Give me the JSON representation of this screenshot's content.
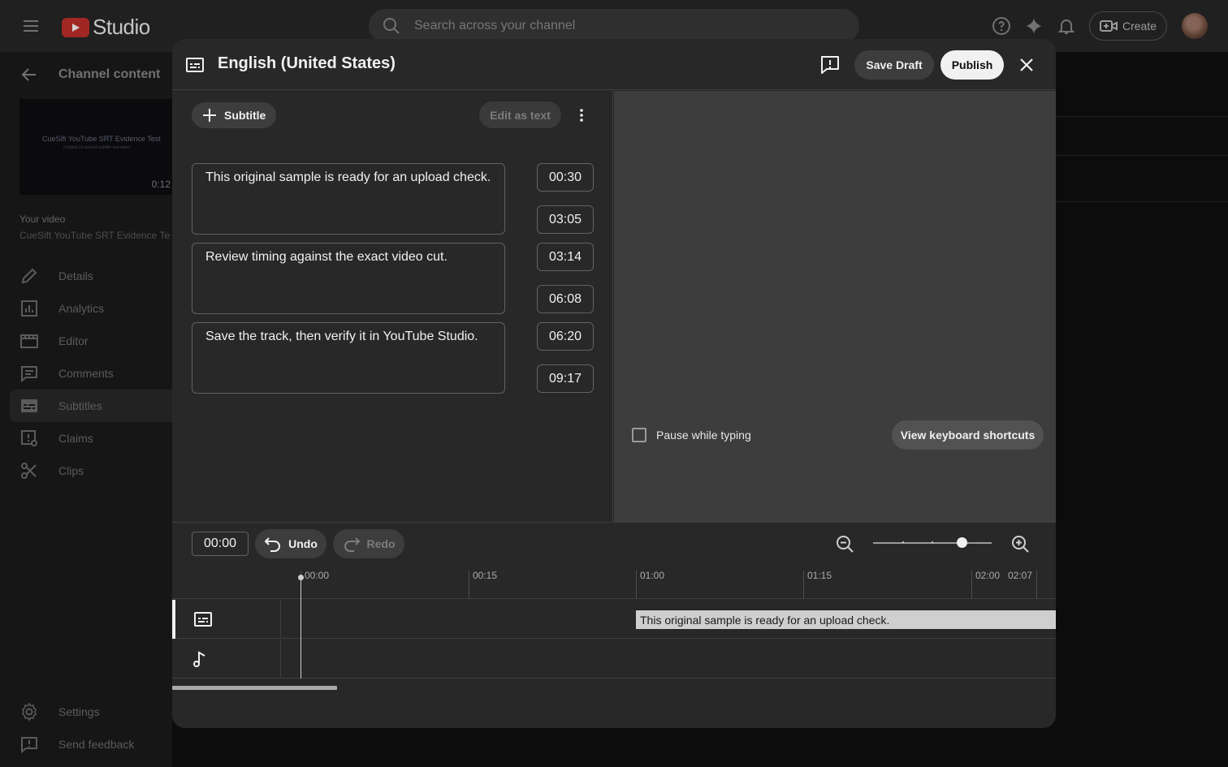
{
  "app": {
    "logo_text": "Studio",
    "search_placeholder": "Search across your channel",
    "create_label": "Create"
  },
  "sidebar": {
    "back_label": "Channel content",
    "thumbnail_title": "CueSift YouTube SRT Evidence Test",
    "thumbnail_subtitle": "Original 12-second subtitle test video",
    "thumbnail_duration": "0:12",
    "your_video_label": "Your video",
    "video_title": "CueSift YouTube SRT Evidence Test",
    "items": [
      {
        "label": "Details",
        "icon": "pencil-icon"
      },
      {
        "label": "Analytics",
        "icon": "analytics-icon"
      },
      {
        "label": "Editor",
        "icon": "film-icon"
      },
      {
        "label": "Comments",
        "icon": "comments-icon"
      },
      {
        "label": "Subtitles",
        "icon": "subtitles-icon",
        "active": true
      },
      {
        "label": "Claims",
        "icon": "claims-icon"
      },
      {
        "label": "Clips",
        "icon": "scissors-icon"
      }
    ],
    "bottom_items": [
      {
        "label": "Settings",
        "icon": "gear-icon"
      },
      {
        "label": "Send feedback",
        "icon": "feedback-icon"
      }
    ]
  },
  "modal": {
    "title": "English (United States)",
    "save_draft_label": "Save Draft",
    "publish_label": "Publish",
    "add_subtitle_label": "Subtitle",
    "edit_as_text_label": "Edit as text",
    "cues": [
      {
        "text": "This original sample is ready for an upload check.",
        "start": "00:30",
        "end": "03:05"
      },
      {
        "text": "Review timing against the exact video cut.",
        "start": "03:14",
        "end": "06:08"
      },
      {
        "text": "Save the track, then verify it in YouTube Studio.",
        "start": "06:20",
        "end": "09:17"
      }
    ],
    "pause_while_typing_label": "Pause while typing",
    "pause_while_typing_checked": false,
    "keyboard_shortcuts_label": "View keyboard shortcuts"
  },
  "timeline": {
    "current_time": "00:00",
    "undo_label": "Undo",
    "redo_label": "Redo",
    "ruler_labels": [
      "00:00",
      "00:15",
      "01:00",
      "01:15",
      "02:00",
      "02:07"
    ],
    "subtitle_track_text": "This original sample is ready for an upload check.",
    "zoom_level": 0.75
  },
  "colors": {
    "background": "#0f0f0f",
    "modal_bg": "#282828",
    "preview_bg": "#3d3d3d",
    "brand_red": "#ff0000",
    "publish_bg": "#f1f1f1"
  }
}
